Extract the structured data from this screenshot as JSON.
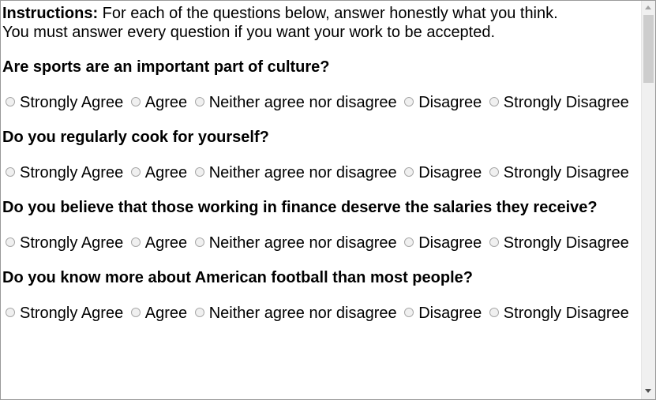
{
  "instructions": {
    "label": "Instructions:",
    "line1": " For each of the questions below, answer honestly what you think.",
    "line2": "You must answer every question if you want your work to be accepted."
  },
  "options": [
    "Strongly Agree",
    "Agree",
    "Neither agree nor disagree",
    "Disagree",
    "Strongly Disagree"
  ],
  "questions": [
    {
      "text": "Are sports are an important part of culture?"
    },
    {
      "text": "Do you regularly cook for yourself?"
    },
    {
      "text": "Do you believe that those working in finance deserve the salaries they receive?"
    },
    {
      "text": "Do you know more about American football than most people?"
    }
  ],
  "scrollbar": {
    "position": 0.0
  }
}
